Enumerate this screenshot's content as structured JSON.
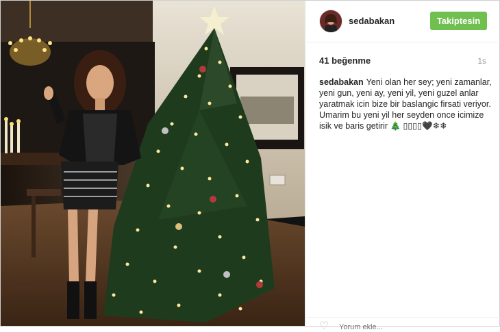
{
  "post": {
    "username": "sedabakan",
    "follow_label": "Takiptesin",
    "likes": "41 beğenme",
    "time": "1s",
    "caption_user": "sedabakan",
    "caption_text": "Yeni olan her sey; yeni zamanlar, yeni gun, yeni ay, yeni yil, yeni guzel anlar yaratmak icin bize bir baslangic firsati veriyor. Umarim bu yeni yil her seyden once icimize isik ve baris getirir 🎄 ▯▯▯▯🖤❄❄",
    "comment_placeholder": "Yorum ekle..."
  },
  "colors": {
    "follow_button": "#70c050",
    "tree": "#1f3b1e",
    "lights": "#ffe8a0"
  },
  "icons": [
    "heart-icon"
  ]
}
